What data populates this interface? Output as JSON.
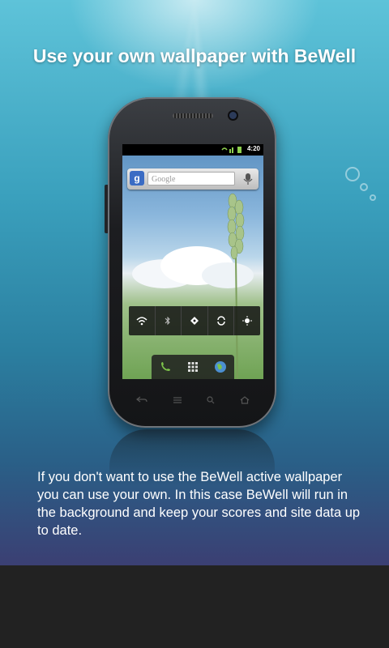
{
  "page": {
    "title": "Use your own wallpaper with BeWell",
    "description": "If you don't want to use the BeWell active wallpaper you can use your own. In this case BeWell will run in the background and keep your scores and site data up to date."
  },
  "phone_mockup": {
    "status_time": "4:20",
    "status_icons": [
      "wifi-icon",
      "signal-icon",
      "battery-icon"
    ],
    "search": {
      "logo": "g",
      "placeholder": "Google"
    },
    "power_widget_icons": [
      "wifi-icon",
      "bluetooth-icon",
      "gps-icon",
      "sync-icon",
      "brightness-icon"
    ],
    "dock_icons": [
      "phone-icon",
      "app-grid-icon",
      "browser-globe-icon"
    ],
    "softkeys": [
      "back-icon",
      "menu-icon",
      "search-icon",
      "home-icon"
    ]
  },
  "colors": {
    "background_top": "#5ec3d9",
    "background_bottom": "#3b3f73",
    "bottom_bar": "#222222",
    "text": "#ffffff"
  }
}
